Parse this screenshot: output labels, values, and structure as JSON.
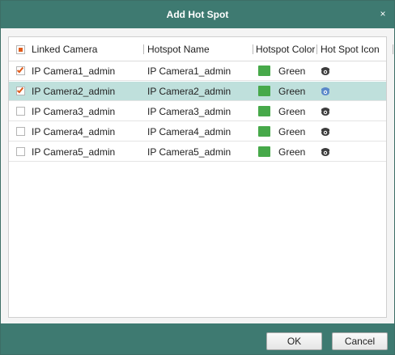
{
  "dialog": {
    "title": "Add Hot Spot",
    "close_glyph": "×"
  },
  "table": {
    "headers": {
      "linked_camera": "Linked Camera",
      "hotspot_name": "Hotspot Name",
      "hotspot_color": "Hotspot Color",
      "hot_spot_icon": "Hot Spot Icon"
    },
    "header_checkbox_state": "partial",
    "rows": [
      {
        "linked_camera": "IP Camera1_admin",
        "hotspot_name": "IP Camera1_admin",
        "color_name": "Green",
        "color_hex": "#47a94a",
        "icon": "camera-dome-icon",
        "checked": true,
        "selected": false
      },
      {
        "linked_camera": "IP Camera2_admin",
        "hotspot_name": "IP Camera2_admin",
        "color_name": "Green",
        "color_hex": "#47a94a",
        "icon": "camera-dome-icon",
        "checked": true,
        "selected": true
      },
      {
        "linked_camera": "IP Camera3_admin",
        "hotspot_name": "IP Camera3_admin",
        "color_name": "Green",
        "color_hex": "#47a94a",
        "icon": "camera-dome-icon",
        "checked": false,
        "selected": false
      },
      {
        "linked_camera": "IP Camera4_admin",
        "hotspot_name": "IP Camera4_admin",
        "color_name": "Green",
        "color_hex": "#47a94a",
        "icon": "camera-dome-icon",
        "checked": false,
        "selected": false
      },
      {
        "linked_camera": "IP Camera5_admin",
        "hotspot_name": "IP Camera5_admin",
        "color_name": "Green",
        "color_hex": "#47a94a",
        "icon": "camera-dome-icon",
        "checked": false,
        "selected": false
      }
    ]
  },
  "footer": {
    "ok_label": "OK",
    "cancel_label": "Cancel"
  },
  "colors": {
    "title_bar": "#3e7a71",
    "selected_row": "#bfe0dc",
    "checkmark": "#e05b1b",
    "swatch_green": "#47a94a"
  }
}
